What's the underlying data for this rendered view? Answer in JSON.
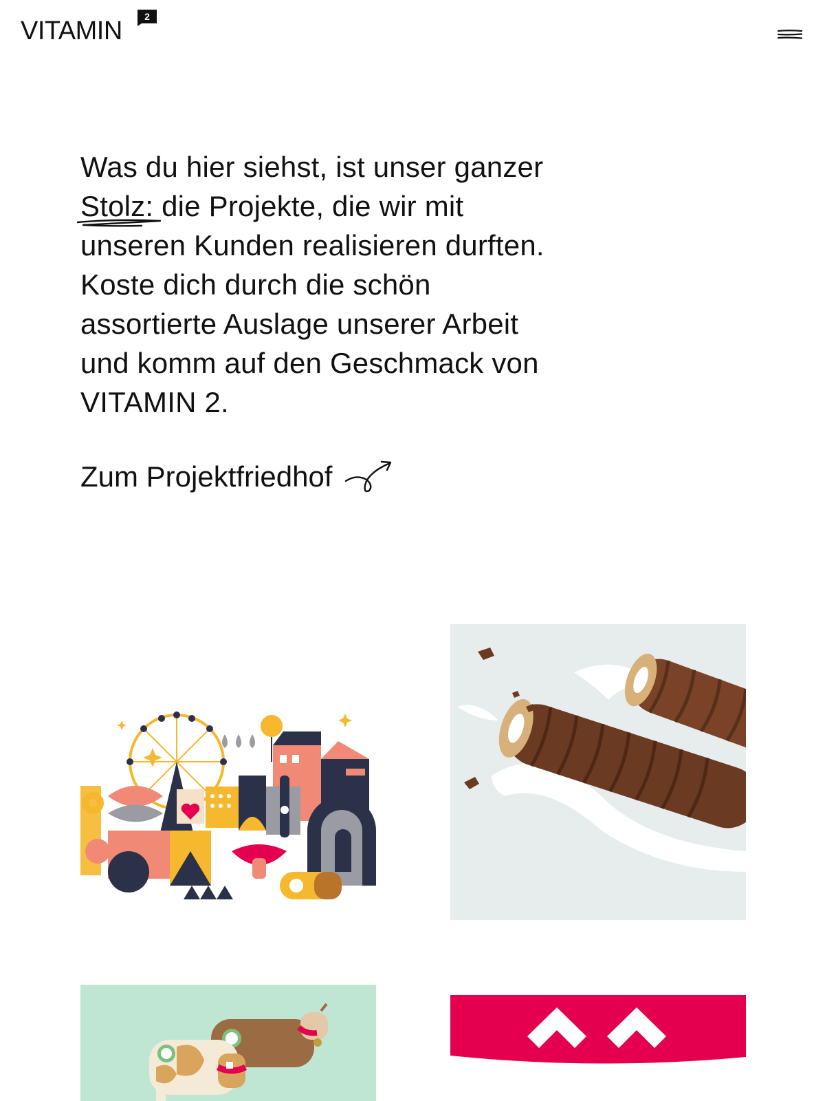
{
  "header": {
    "logo_text": "VITAMIN",
    "logo_badge": "2",
    "menu_icon": "hamburger-icon"
  },
  "intro": {
    "lines": [
      "Was du hier siehst, ist unser ganzer",
      "die Projekte, die wir mit",
      "unseren Kunden realisieren durften.",
      "Koste dich durch die schön",
      "assortierte Auslage unserer Arbeit",
      "und komm auf den Geschmack von",
      "VITAMIN 2."
    ],
    "highlight": "Stolz:",
    "underline_icon": "scribble-underline"
  },
  "cta": {
    "label": "Zum Projektfriedhof",
    "icon": "curly-arrow-icon"
  },
  "projects": [
    {
      "name": "illustration-city",
      "bg": "#ffffff"
    },
    {
      "name": "chocolate-wafer",
      "bg": "#e7ecec"
    },
    {
      "name": "wooden-cows",
      "bg": "#bfe6d3"
    },
    {
      "name": "red-chevrons",
      "bg": "#e4004f"
    }
  ],
  "colors": {
    "text": "#111111",
    "accent_red": "#e4004f",
    "mint": "#bfe6d3",
    "navy": "#2b3148",
    "salmon": "#f08a76",
    "yellow": "#f5b82e"
  }
}
